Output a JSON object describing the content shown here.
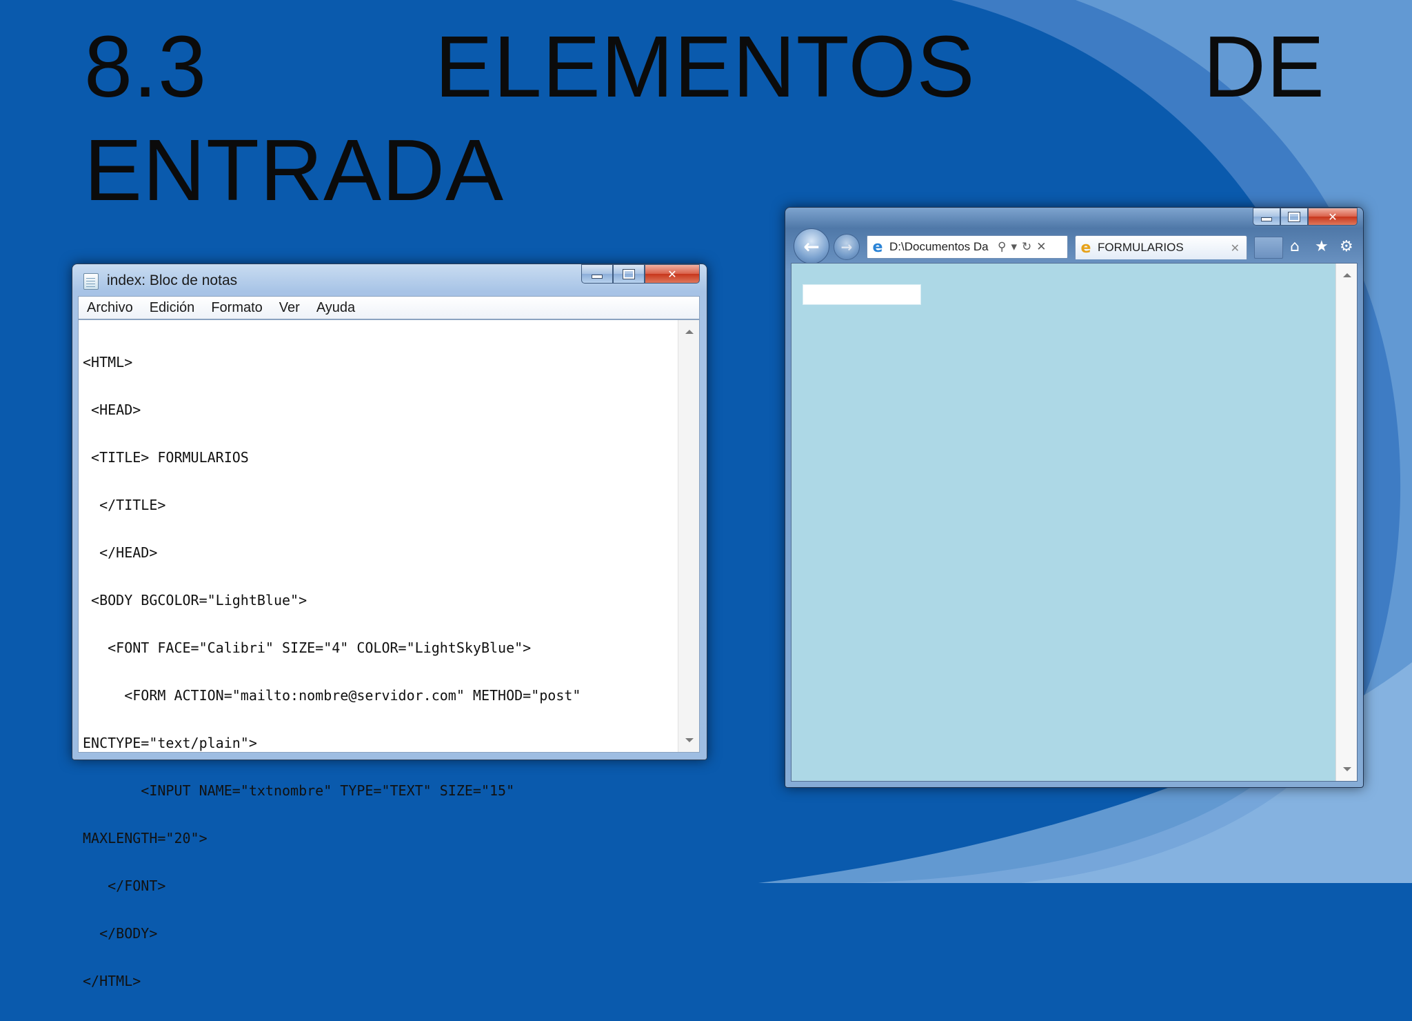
{
  "slide": {
    "title_line1": [
      "8.3",
      "ELEMENTOS",
      "DE"
    ],
    "title_line2": "ENTRADA"
  },
  "notepad": {
    "title": "index: Bloc de notas",
    "menu": [
      "Archivo",
      "Edición",
      "Formato",
      "Ver",
      "Ayuda"
    ],
    "lines": [
      "<HTML>",
      " <HEAD>",
      " <TITLE> FORMULARIOS",
      "  </TITLE>",
      "  </HEAD>",
      " <BODY BGCOLOR=\"LightBlue\">",
      "   <FONT FACE=\"Calibri\" SIZE=\"4\" COLOR=\"LightSkyBlue\">",
      "     <FORM ACTION=\"mailto:nombre@servidor.com\" METHOD=\"post\"",
      "ENCTYPE=\"text/plain\">",
      "       <INPUT NAME=\"txtnombre\" TYPE=\"TEXT\" SIZE=\"15\"",
      "MAXLENGTH=\"20\">",
      "   </FONT>",
      "  </BODY>",
      "</HTML>"
    ]
  },
  "browser": {
    "address": "D:\\Documentos Da",
    "tab_title": "FORMULARIOS",
    "page_bgcolor": "#add8e6"
  },
  "icons": {
    "back": "arrow-left-icon",
    "forward": "arrow-right-icon",
    "search": "search-icon",
    "refresh": "refresh-icon",
    "stop": "close-icon",
    "home": "home-icon",
    "favorites": "star-icon",
    "tools": "gear-icon"
  },
  "colors": {
    "slide_background": "#0a5aad",
    "swoosh": "#7fb0e0"
  }
}
